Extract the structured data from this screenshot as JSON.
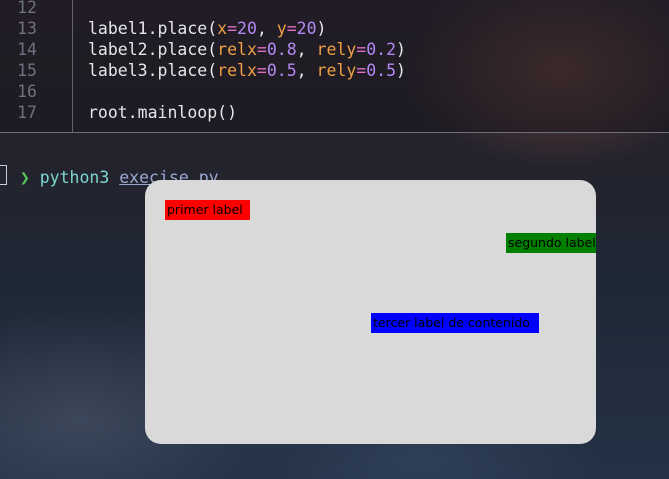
{
  "editor": {
    "lines": [
      {
        "num": "12",
        "tokens": []
      },
      {
        "num": "13",
        "tokens": [
          {
            "t": "label1.place(",
            "c": "fn"
          },
          {
            "t": "x",
            "c": "kw"
          },
          {
            "t": "=",
            "c": "op"
          },
          {
            "t": "20",
            "c": "num"
          },
          {
            "t": ", ",
            "c": "p"
          },
          {
            "t": "y",
            "c": "kw"
          },
          {
            "t": "=",
            "c": "op"
          },
          {
            "t": "20",
            "c": "num"
          },
          {
            "t": ")",
            "c": "p"
          }
        ]
      },
      {
        "num": "14",
        "tokens": [
          {
            "t": "label2.place(",
            "c": "fn"
          },
          {
            "t": "relx",
            "c": "kw"
          },
          {
            "t": "=",
            "c": "op"
          },
          {
            "t": "0.8",
            "c": "num"
          },
          {
            "t": ", ",
            "c": "p"
          },
          {
            "t": "rely",
            "c": "kw"
          },
          {
            "t": "=",
            "c": "op"
          },
          {
            "t": "0.2",
            "c": "num"
          },
          {
            "t": ")",
            "c": "p"
          }
        ]
      },
      {
        "num": "15",
        "tokens": [
          {
            "t": "label3.place(",
            "c": "fn"
          },
          {
            "t": "relx",
            "c": "kw"
          },
          {
            "t": "=",
            "c": "op"
          },
          {
            "t": "0.5",
            "c": "num"
          },
          {
            "t": ", ",
            "c": "p"
          },
          {
            "t": "rely",
            "c": "kw"
          },
          {
            "t": "=",
            "c": "op"
          },
          {
            "t": "0.5",
            "c": "num"
          },
          {
            "t": ")",
            "c": "p"
          }
        ]
      },
      {
        "num": "16",
        "tokens": []
      },
      {
        "num": "17",
        "tokens": [
          {
            "t": "root.mainloop()",
            "c": "fn"
          }
        ]
      }
    ]
  },
  "terminal": {
    "prompt_symbol": "❯",
    "command": "python3",
    "argument": "execise.py"
  },
  "tk_window": {
    "background": "#d9d9d9",
    "labels": [
      {
        "text": "primer label",
        "bg": "#ff0000"
      },
      {
        "text": "segundo label",
        "bg": "#008000"
      },
      {
        "text": "tercer label de contenido",
        "bg": "#0000ff"
      }
    ]
  }
}
